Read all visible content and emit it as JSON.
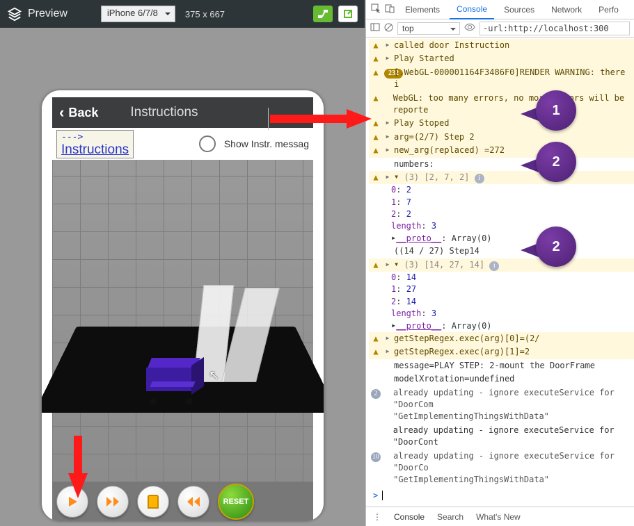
{
  "toolbar": {
    "title": "Preview",
    "device": "iPhone 6/7/8",
    "dims": "375 x 667"
  },
  "phone": {
    "back": "Back",
    "title": "Instructions",
    "hint_line1": "--->",
    "hint_line2": "Instructions",
    "toggle_label": "Show Instr. messag",
    "reset": "RESET"
  },
  "devtools": {
    "tabs": {
      "elements": "Elements",
      "console": "Console",
      "sources": "Sources",
      "network": "Network",
      "perf": "Perfo"
    },
    "context": "top",
    "filter": "-url:http://localhost:300",
    "drawer": {
      "console": "Console",
      "search": "Search",
      "whatsnew": "What's New"
    }
  },
  "log": {
    "l1": "called door Instruction",
    "l2": "Play Started",
    "l3_badge": "232",
    "l3": "[.WebGL-000001164F3486F0]RENDER WARNING: there i",
    "l4": "WebGL: too many errors, no more errors will be reporte",
    "l5": "Play Stoped",
    "l6": "arg=(2/7) Step 2",
    "l7": "new_arg(replaced) =272",
    "l8": "numbers:",
    "a1_hdr": "(3) [2, 7, 2]",
    "a1": [
      [
        "0",
        "2"
      ],
      [
        "1",
        "7"
      ],
      [
        "2",
        "2"
      ],
      [
        "length",
        "3"
      ]
    ],
    "proto": "__proto__",
    "proto_v": ": Array(0)",
    "l10": "((14 / 27) Step14",
    "a2_hdr": "(3) [14, 27, 14]",
    "a2": [
      [
        "0",
        "14"
      ],
      [
        "1",
        "27"
      ],
      [
        "2",
        "14"
      ],
      [
        "length",
        "3"
      ]
    ],
    "l12": "getStepRegex.exec(arg)[0]=(2/",
    "l13": "getStepRegex.exec(arg)[1]=2",
    "l14": "message=PLAY STEP: 2-mount the DoorFrame",
    "l15": "modelXrotation=undefined",
    "l16a": "already updating - ignore executeService for \"DoorCom",
    "l16b": "\"GetImplementingThingsWithData\"",
    "l17": "already updating - ignore executeService for \"DoorCont",
    "l18a": "already updating - ignore executeService for \"DoorCo",
    "l18b": "\"GetImplementingThingsWithData\"",
    "b16": "2",
    "b18": "10"
  },
  "bubbles": {
    "b1": "1",
    "b2": "2",
    "b3": "2"
  }
}
